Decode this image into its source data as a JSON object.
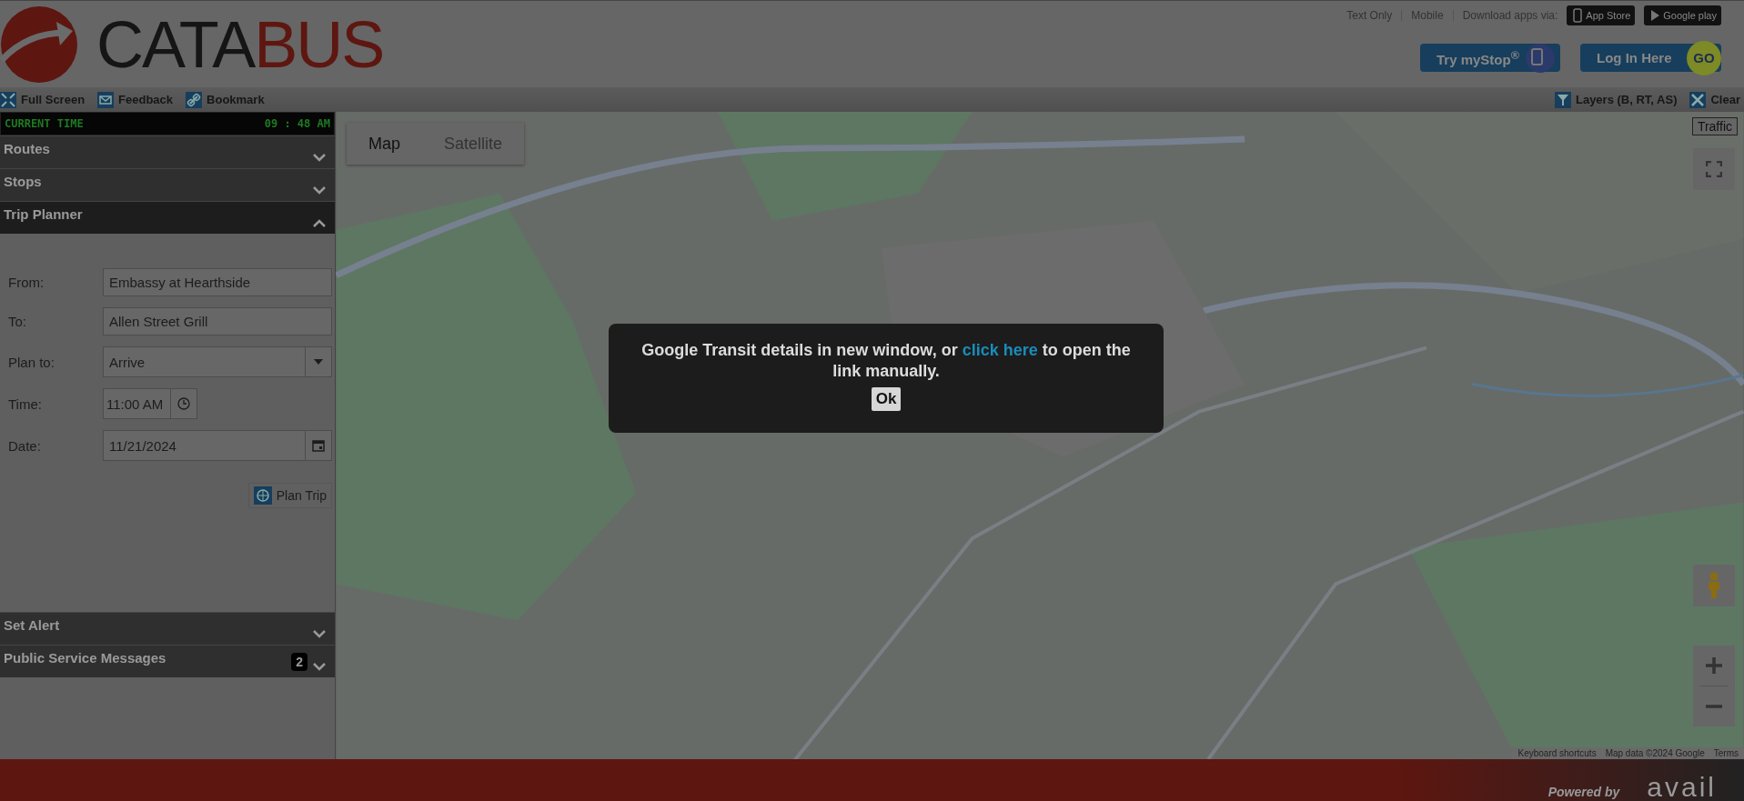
{
  "header": {
    "logo": {
      "name": "CATA",
      "accent": "BUS"
    },
    "top_links": [
      "Text Only",
      "Mobile"
    ],
    "download_label": "Download apps via:",
    "store_badges": [
      {
        "kind": "apple",
        "label": "App Store"
      },
      {
        "kind": "google",
        "label": "Google play"
      }
    ],
    "buttons": [
      {
        "kind": "mystop",
        "label": "Try myStop$^{®}$"
      },
      {
        "kind": "login",
        "label": "Log In Here",
        "badge": "GO"
      }
    ]
  },
  "toolbar": {
    "left": [
      {
        "kind": "fullscreen",
        "label": "Full Screen"
      },
      {
        "kind": "feedback",
        "label": "Feedback"
      },
      {
        "kind": "bookmark",
        "label": "Bookmark"
      }
    ],
    "right": [
      {
        "kind": "layers",
        "label": "Layers (B, RT, AS)"
      },
      {
        "kind": "clear",
        "label": "Clear"
      }
    ]
  },
  "sidebar": {
    "clock": {
      "label": "CURRENT TIME",
      "time": "09 : 48 AM"
    },
    "sections": [
      {
        "title": "Routes",
        "expanded": false
      },
      {
        "title": "Stops",
        "expanded": false
      },
      {
        "title": "Trip Planner",
        "expanded": true
      },
      {
        "title": "Set Alert",
        "expanded": false
      },
      {
        "title": "Public Service Messages",
        "expanded": false,
        "badge": "2"
      }
    ],
    "trip_planner": {
      "fields": [
        {
          "kind": "text",
          "label": "From:",
          "value": "Embassy at Hearthside"
        },
        {
          "kind": "text",
          "label": "To:",
          "value": "Allen Street Grill"
        },
        {
          "kind": "select",
          "label": "Plan to:",
          "value": "Arrive"
        },
        {
          "kind": "time",
          "label": "Time:",
          "value": "11:00 AM"
        },
        {
          "kind": "date",
          "label": "Date:",
          "value": "11/21/2024"
        }
      ],
      "submit": "Plan Trip"
    }
  },
  "map": {
    "kind": "picture",
    "map_types": [
      {
        "label": "Map",
        "selected": true
      },
      {
        "label": "Satellite",
        "selected": false
      }
    ],
    "traffic": "Traffic",
    "attribution": [
      "Keyboard shortcuts",
      "Map data ©2024 Google",
      "Terms"
    ]
  },
  "dialog": {
    "text_before": "Google Transit details in new window, or ",
    "link": "click here",
    "text_after": " to open the link manually.",
    "button": "Ok"
  },
  "footer": {
    "powered_by": "Powered by",
    "brand": "avail"
  }
}
